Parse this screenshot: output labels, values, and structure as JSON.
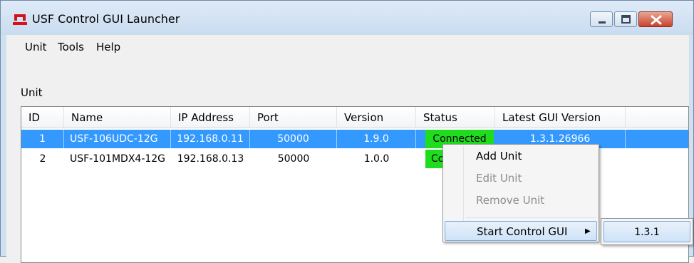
{
  "window": {
    "title": "USF Control GUI Launcher",
    "accent": "#3399ff",
    "icons": {
      "app": "usf-logo-icon",
      "minimize": "minimize-icon",
      "maximize": "maximize-icon",
      "close": "close-icon"
    }
  },
  "menubar": {
    "items": [
      "Unit",
      "Tools",
      "Help"
    ]
  },
  "unit_group": {
    "label": "Unit"
  },
  "table": {
    "columns": [
      "ID",
      "Name",
      "IP Address",
      "Port",
      "Version",
      "Status",
      "Latest GUI Version"
    ],
    "rows": [
      {
        "id": "1",
        "name": "USF-106UDC-12G",
        "ip": "192.168.0.11",
        "port": "50000",
        "version": "1.9.0",
        "status": "Connected",
        "latest": "1.3.1.26966",
        "selected": true
      },
      {
        "id": "2",
        "name": "USF-101MDX4-12G",
        "ip": "192.168.0.13",
        "port": "50000",
        "version": "1.0.0",
        "status": "Co",
        "latest": "",
        "selected": false
      }
    ],
    "status_color": "#1fdc1f"
  },
  "context_menu": {
    "items": [
      {
        "label": "Add Unit",
        "enabled": true
      },
      {
        "label": "Edit Unit",
        "enabled": false
      },
      {
        "label": "Remove Unit",
        "enabled": false
      },
      {
        "label": "Start Control GUI",
        "enabled": true,
        "submenu": true
      }
    ],
    "submenu_arrow": "▶",
    "submenu": {
      "items": [
        "1.3.1"
      ]
    }
  }
}
